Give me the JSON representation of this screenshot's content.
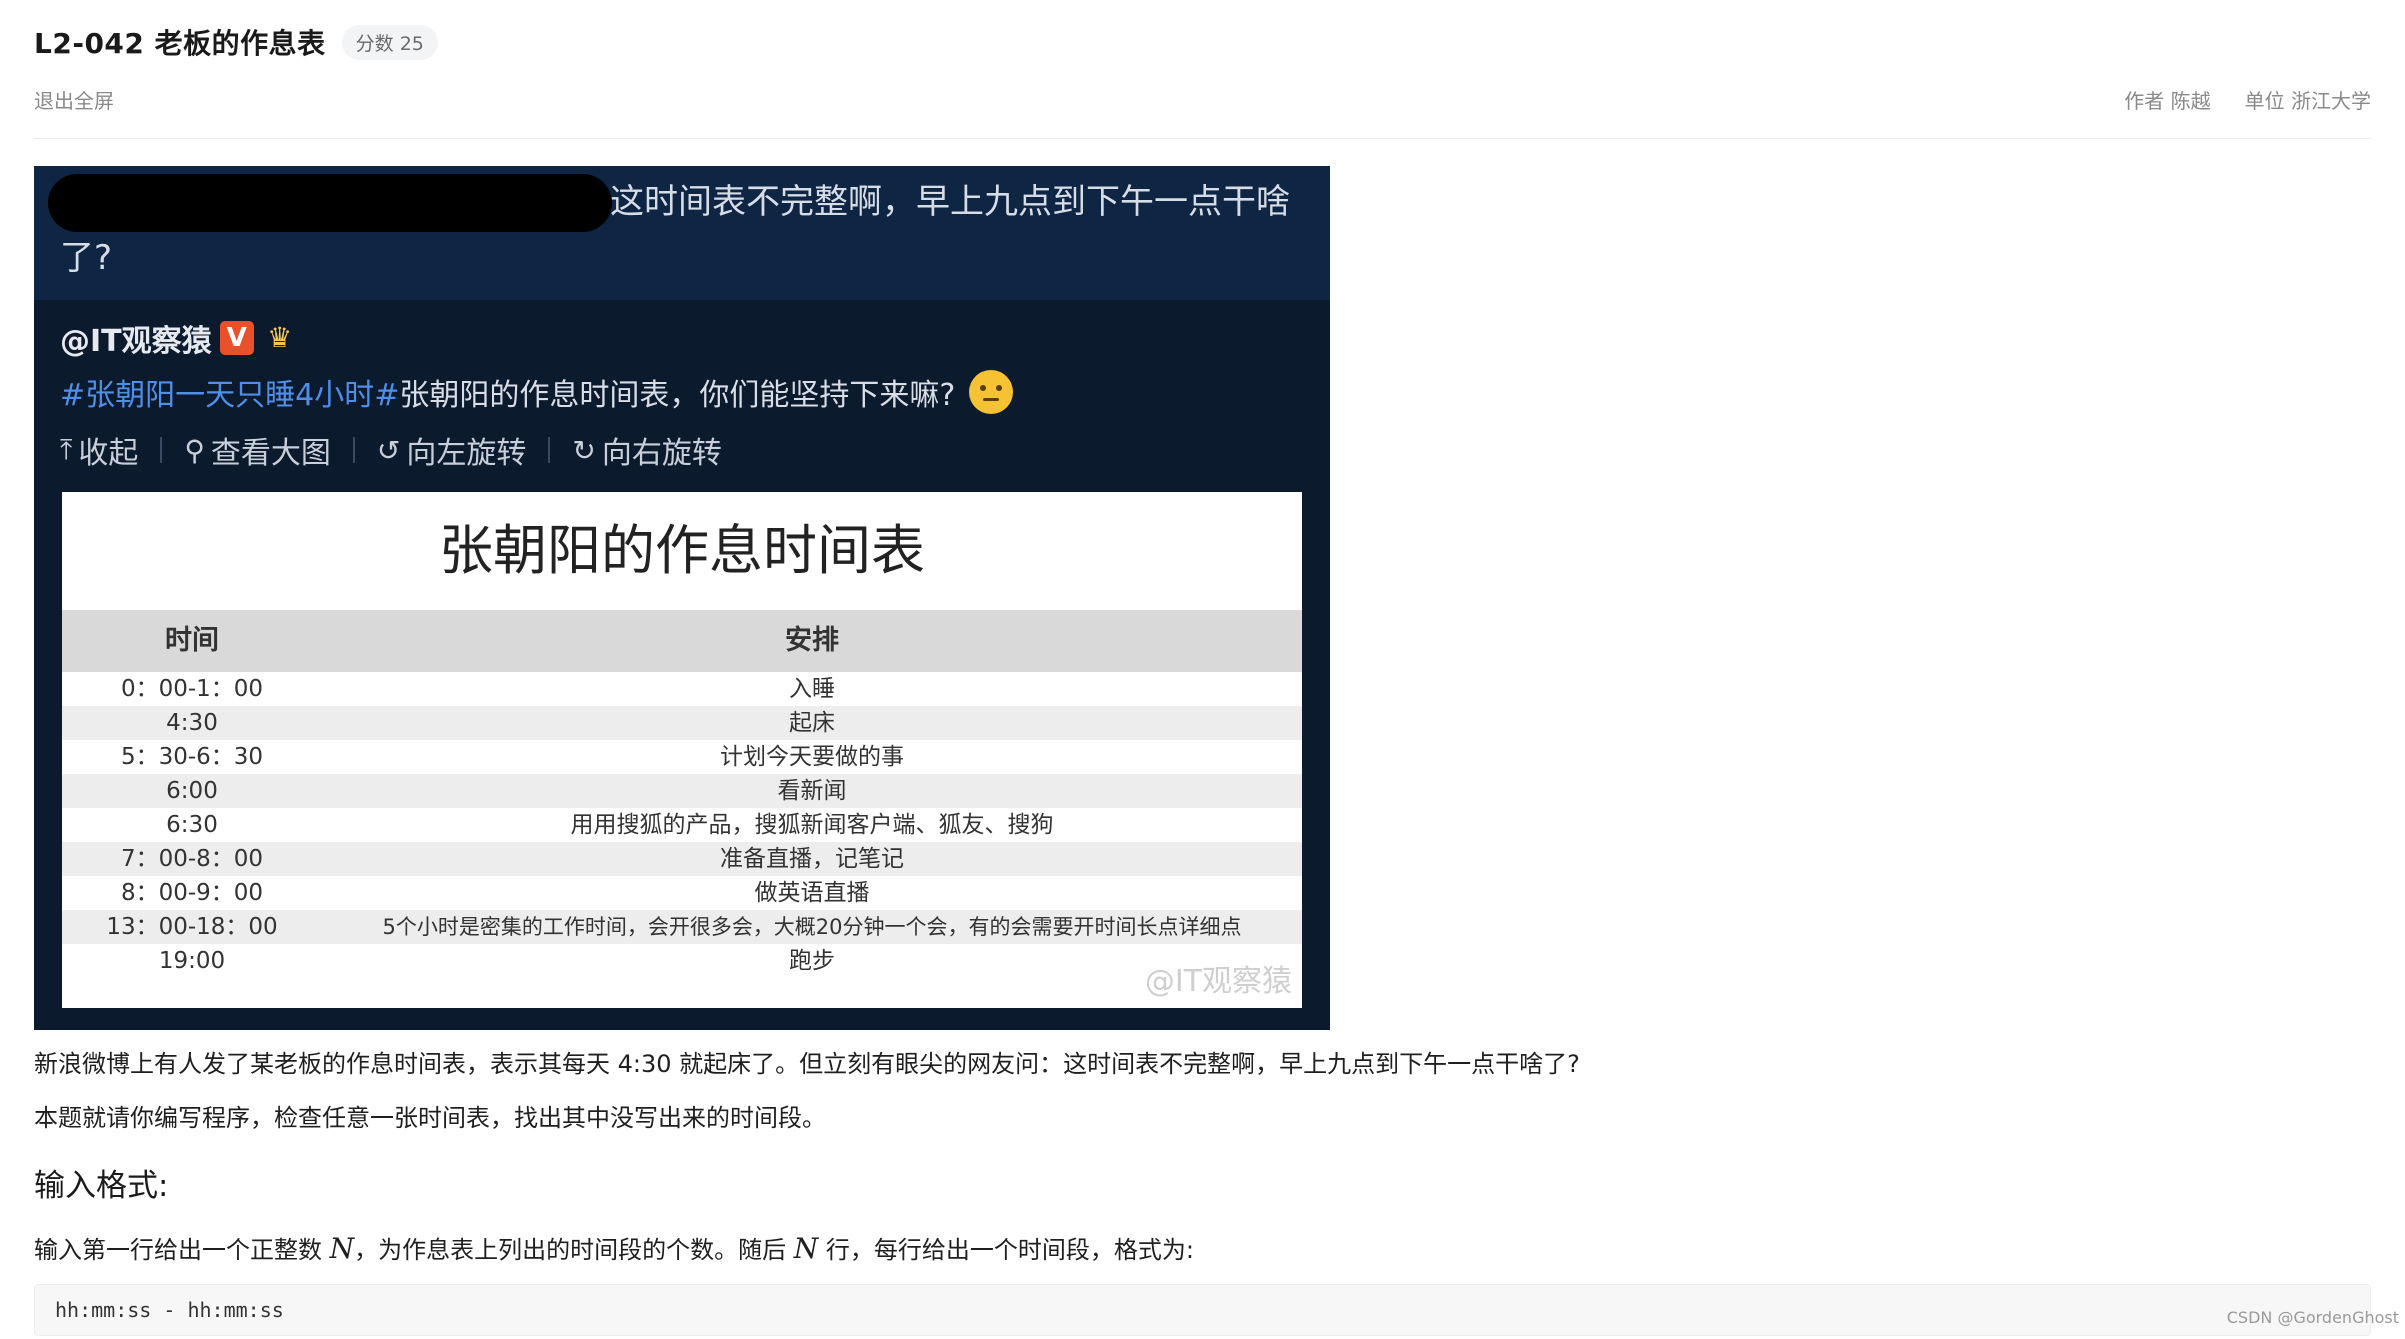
{
  "header": {
    "title": "L2-042 老板的作息表",
    "score": "分数 25",
    "exit_fullscreen": "退出全屏",
    "author": "作者 陈越",
    "unit": "单位 浙江大学"
  },
  "screenshot": {
    "quote": "这时间表不完整啊，早上九点到下午一点干啥了?",
    "username": "@IT观察猿",
    "verified_badge": "V",
    "hashtag": "#张朝阳一天只睡4小时#",
    "post_text": "张朝阳的作息时间表，你们能坚持下来嘛?",
    "actions": [
      {
        "icon": "collapse-icon",
        "label": "收起"
      },
      {
        "icon": "search-icon",
        "label": "查看大图"
      },
      {
        "icon": "rotate-left-icon",
        "label": "向左旋转"
      },
      {
        "icon": "rotate-right-icon",
        "label": "向右旋转"
      }
    ],
    "schedule": {
      "title": "张朝阳的作息时间表",
      "headers": [
        "时间",
        "安排"
      ],
      "rows": [
        [
          "0：00-1：00",
          "入睡"
        ],
        [
          "4:30",
          "起床"
        ],
        [
          "5：30-6：30",
          "计划今天要做的事"
        ],
        [
          "6:00",
          "看新闻"
        ],
        [
          "6:30",
          "用用搜狐的产品，搜狐新闻客户端、狐友、搜狗"
        ],
        [
          "7：00-8：00",
          "准备直播，记笔记"
        ],
        [
          "8：00-9：00",
          "做英语直播"
        ],
        [
          "13：00-18：00",
          "5个小时是密集的工作时间，会开很多会，大概20分钟一个会，有的会需要开时间长点详细点"
        ],
        [
          "19:00",
          "跑步"
        ]
      ],
      "watermark": "@IT观察猿"
    }
  },
  "body": {
    "para1": "新浪微博上有人发了某老板的作息时间表，表示其每天 4:30 就起床了。但立刻有眼尖的网友问：这时间表不完整啊，早上九点到下午一点干啥了?",
    "para2": "本题就请你编写程序，检查任意一张时间表，找出其中没写出来的时间段。",
    "section_input": "输入格式:",
    "para3_a": "输入第一行给出一个正整数 ",
    "para3_var1": "N",
    "para3_b": "，为作息表上列出的时间段的个数。随后 ",
    "para3_var2": "N",
    "para3_c": " 行，每行给出一个时间段，格式为:",
    "code": "hh:mm:ss - hh:mm:ss"
  },
  "footer": {
    "watermark": "CSDN @GordenGhost"
  }
}
